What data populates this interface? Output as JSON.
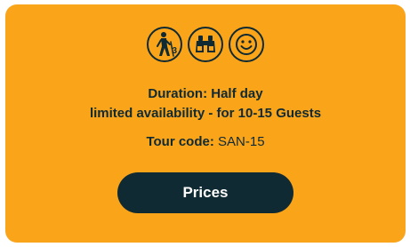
{
  "card": {
    "background_color": "#FAA41A",
    "text_color": "#0f2a33"
  },
  "icons": [
    {
      "name": "hiking-difficulty-icon",
      "level": "3"
    },
    {
      "name": "binoculars-icon"
    },
    {
      "name": "smiley-face-icon"
    }
  ],
  "details": {
    "duration": "Duration: Half day",
    "availability": "limited availability - for 10-15 Guests",
    "tour_code_label": "Tour code:",
    "tour_code_value": "SAN-15"
  },
  "button": {
    "label": "Prices",
    "background_color": "#0f2a33",
    "text_color": "#ffffff"
  }
}
